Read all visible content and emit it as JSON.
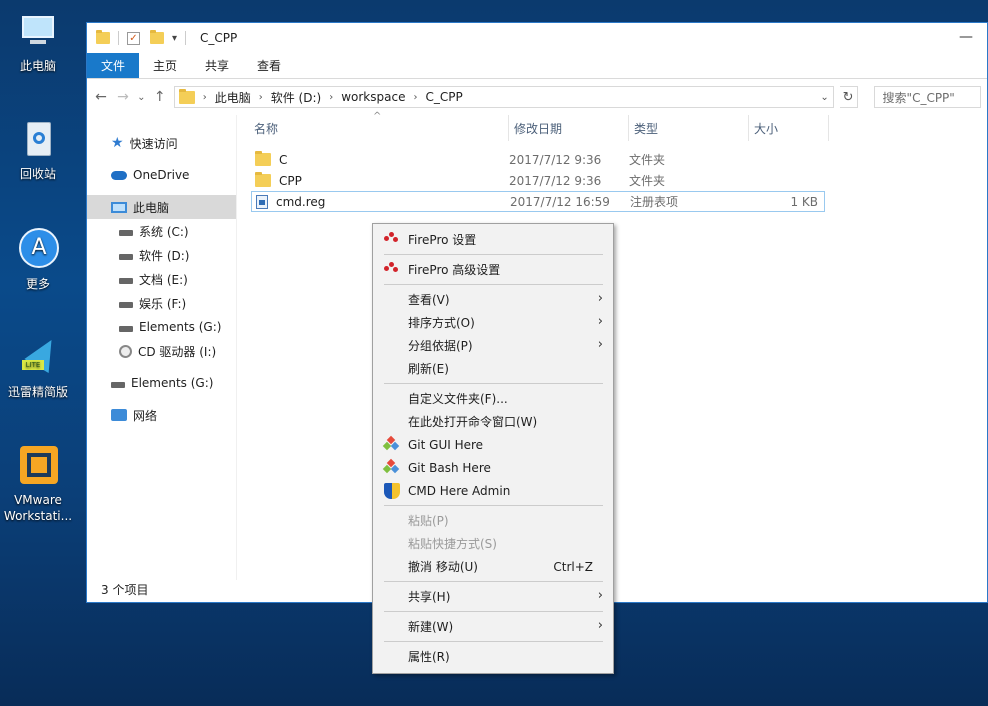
{
  "desktop": {
    "icons": [
      {
        "label1": "此电脑",
        "label2": ""
      },
      {
        "label1": "回收站",
        "label2": ""
      },
      {
        "label1": "更多",
        "label2": ""
      },
      {
        "label1": "迅雷精简版",
        "label2": ""
      },
      {
        "label1": "VMware",
        "label2": "Workstati..."
      }
    ]
  },
  "window": {
    "title": "C_CPP",
    "ribbon_tabs": [
      "文件",
      "主页",
      "共享",
      "查看"
    ],
    "address": [
      "此电脑",
      "软件 (D:)",
      "workspace",
      "C_CPP"
    ],
    "search_placeholder": "搜索\"C_CPP\"",
    "nav": {
      "quick_access": "快速访问",
      "onedrive": "OneDrive",
      "this_pc": "此电脑",
      "drives": [
        "系统 (C:)",
        "软件 (D:)",
        "文档 (E:)",
        "娱乐 (F:)",
        "Elements (G:)",
        "CD 驱动器 (I:)"
      ],
      "elements": "Elements (G:)",
      "network": "网络"
    },
    "columns": [
      "名称",
      "修改日期",
      "类型",
      "大小"
    ],
    "files": [
      {
        "name": "C",
        "date": "2017/7/12 9:36",
        "type": "文件夹",
        "size": ""
      },
      {
        "name": "CPP",
        "date": "2017/7/12 9:36",
        "type": "文件夹",
        "size": ""
      },
      {
        "name": "cmd.reg",
        "date": "2017/7/12 16:59",
        "type": "注册表项",
        "size": "1 KB"
      }
    ],
    "status": "3 个项目"
  },
  "context_menu": {
    "firepro_settings": "FirePro 设置",
    "firepro_advanced": "FirePro 高级设置",
    "view": "查看(V)",
    "sort_by": "排序方式(O)",
    "group_by": "分组依据(P)",
    "refresh": "刷新(E)",
    "customize": "自定义文件夹(F)...",
    "open_cmd": "在此处打开命令窗口(W)",
    "git_gui": "Git GUI Here",
    "git_bash": "Git Bash Here",
    "cmd_admin": "CMD Here Admin",
    "paste": "粘贴(P)",
    "paste_shortcut": "粘贴快捷方式(S)",
    "undo_move": "撤消 移动(U)",
    "undo_shortcut": "Ctrl+Z",
    "share": "共享(H)",
    "new": "新建(W)",
    "properties": "属性(R)"
  }
}
